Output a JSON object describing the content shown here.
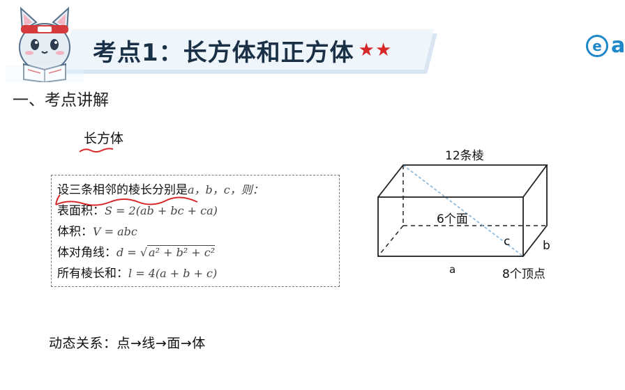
{
  "header": {
    "title": "考点1：长方体和正方体",
    "stars": "★★"
  },
  "brand": {
    "logo_letter": "e",
    "text": "a"
  },
  "section": {
    "heading": "一、考点讲解"
  },
  "subhead": "长方体",
  "formula_box": {
    "intro": {
      "label": "设三条相邻的棱长分别是",
      "math": "a，b，c，则："
    },
    "surface": {
      "label": "表面积：",
      "math": "S = 2(ab + bc + ca)"
    },
    "volume": {
      "label": "体积：",
      "math": "V = abc"
    },
    "diagonal": {
      "label": "体对角线：",
      "math_prefix": "d = ",
      "math_radicand": "a² + b² + c²"
    },
    "edges": {
      "label": "所有棱长和：",
      "math": "l = 4(a + b + c)"
    }
  },
  "dynamic_relation": "动态关系：点→线→面→体",
  "diagram": {
    "edges_label": "12条棱",
    "faces_label": "6个面",
    "vertices_label": "8个顶点",
    "label_a": "a",
    "label_b": "b",
    "label_c": "c"
  },
  "colors": {
    "accent_red": "#d62828",
    "title_navy": "#1a3046",
    "brand_blue": "#1e88c8",
    "diagonal_blue": "#8fbbe0"
  }
}
